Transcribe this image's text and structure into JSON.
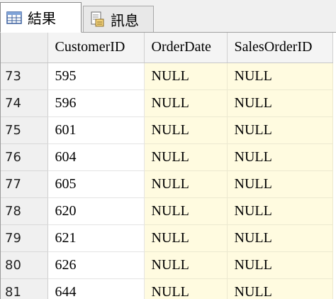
{
  "tabs": [
    {
      "label": "結果",
      "icon": "grid-icon",
      "active": true
    },
    {
      "label": "訊息",
      "icon": "message-document-icon",
      "active": false
    }
  ],
  "colors": {
    "null_cell_bg": "#fffbe0",
    "header_bg": "#f4f4f4"
  },
  "grid": {
    "columns": [
      "",
      "CustomerID",
      "OrderDate",
      "SalesOrderID"
    ],
    "rows": [
      [
        "73",
        "595",
        "NULL",
        "NULL"
      ],
      [
        "74",
        "596",
        "NULL",
        "NULL"
      ],
      [
        "75",
        "601",
        "NULL",
        "NULL"
      ],
      [
        "76",
        "604",
        "NULL",
        "NULL"
      ],
      [
        "77",
        "605",
        "NULL",
        "NULL"
      ],
      [
        "78",
        "620",
        "NULL",
        "NULL"
      ],
      [
        "79",
        "621",
        "NULL",
        "NULL"
      ],
      [
        "80",
        "626",
        "NULL",
        "NULL"
      ],
      [
        "81",
        "644",
        "NULL",
        "NULL"
      ]
    ]
  }
}
